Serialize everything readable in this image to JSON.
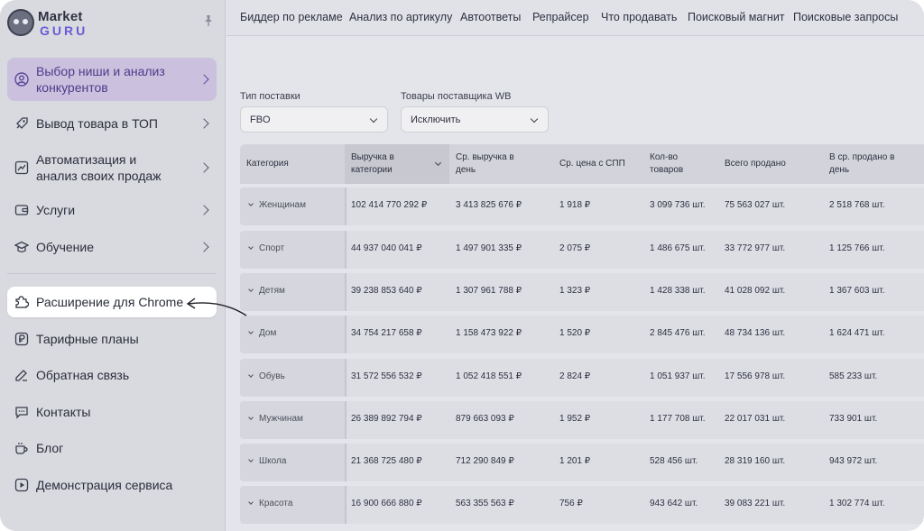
{
  "brand": {
    "line1": "Market",
    "line2": "GURU"
  },
  "sidebar": {
    "items": [
      {
        "label": "Выбор ниши и анализ конкурентов",
        "icon": "user-circle-icon"
      },
      {
        "label": "Вывод товара в ТОП",
        "icon": "rocket-icon"
      },
      {
        "label": "Автоматизация и анализ своих продаж",
        "icon": "chart-line-icon"
      },
      {
        "label": "Услуги",
        "icon": "wallet-icon"
      },
      {
        "label": "Обучение",
        "icon": "graduation-cap-icon"
      },
      {
        "label": "Расширение для Chrome",
        "icon": "puzzle-icon"
      },
      {
        "label": "Тарифные планы",
        "icon": "ruble-icon"
      },
      {
        "label": "Обратная связь",
        "icon": "edit-icon"
      },
      {
        "label": "Контакты",
        "icon": "chat-icon"
      },
      {
        "label": "Блог",
        "icon": "coffee-cup-icon"
      },
      {
        "label": "Демонстрация сервиса",
        "icon": "play-icon"
      }
    ]
  },
  "topbar": {
    "tabs": [
      "Биддер по рекламе",
      "Анализ по артикулу",
      "Автоответы",
      "Репрайсер",
      "Что продавать",
      "Поисковый магнит",
      "Поисковые запросы"
    ]
  },
  "filters": {
    "supply_type": {
      "label": "Тип поставки",
      "value": "FBO"
    },
    "wb_goods": {
      "label": "Товары поставщика WB",
      "value": "Исключить"
    }
  },
  "table": {
    "headers": [
      "Категория",
      "Выручка в категории",
      "Ср. выручка в день",
      "Ср. цена с СПП",
      "Кол-во товаров",
      "Всего продано",
      "В ср. продано в день"
    ],
    "rows": [
      [
        "Женщинам",
        "102 414 770 292 ₽",
        "3 413 825 676 ₽",
        "1 918 ₽",
        "3 099 736 шт.",
        "75 563 027 шт.",
        "2 518 768 шт."
      ],
      [
        "Спорт",
        "44 937 040 041 ₽",
        "1 497 901 335 ₽",
        "2 075 ₽",
        "1 486 675 шт.",
        "33 772 977 шт.",
        "1 125 766 шт."
      ],
      [
        "Детям",
        "39 238 853 640 ₽",
        "1 307 961 788 ₽",
        "1 323 ₽",
        "1 428 338 шт.",
        "41 028 092 шт.",
        "1 367 603 шт."
      ],
      [
        "Дом",
        "34 754 217 658 ₽",
        "1 158 473 922 ₽",
        "1 520 ₽",
        "2 845 476 шт.",
        "48 734 136 шт.",
        "1 624 471 шт."
      ],
      [
        "Обувь",
        "31 572 556 532 ₽",
        "1 052 418 551 ₽",
        "2 824 ₽",
        "1 051 937 шт.",
        "17 556 978 шт.",
        "585 233 шт."
      ],
      [
        "Мужчинам",
        "26 389 892 794 ₽",
        "879 663 093 ₽",
        "1 952 ₽",
        "1 177 708 шт.",
        "22 017 031 шт.",
        "733 901 шт."
      ],
      [
        "Школа",
        "21 368 725 480 ₽",
        "712 290 849 ₽",
        "1 201 ₽",
        "528 456 шт.",
        "28 319 160 шт.",
        "943 972 шт."
      ],
      [
        "Красота",
        "16 900 666 880 ₽",
        "563 355 563 ₽",
        "756 ₽",
        "943 642 шт.",
        "39 083 221 шт.",
        "1 302 774 шт."
      ]
    ]
  }
}
